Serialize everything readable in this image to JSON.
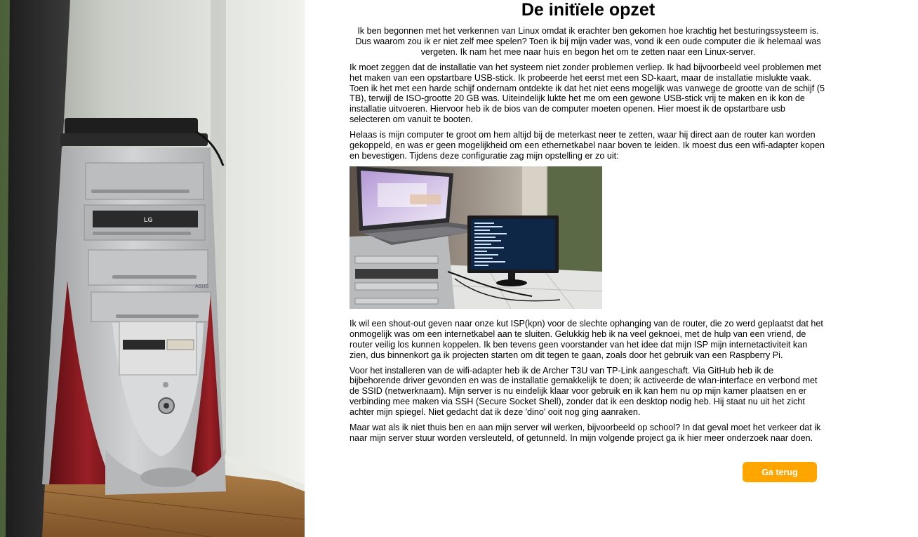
{
  "article": {
    "title": "De initïele opzet",
    "intro": "Ik ben begonnen met het verkennen van Linux omdat ik erachter ben gekomen hoe krachtig het besturingssysteem is. Dus waarom zou ik er niet zelf mee spelen? Toen ik bij mijn vader was, vond ik een oude computer die ik helemaal was vergeten. Ik nam het mee naar huis en begon het om te zetten naar een Linux-server.",
    "paragraph_install": "Ik moet zeggen dat de installatie van het systeem niet zonder problemen verliep. Ik had bijvoorbeeld veel problemen met het maken van een opstartbare USB-stick. Ik probeerde het eerst met een SD-kaart, maar de installatie mislukte vaak. Toen ik het met een harde schijf ondernam ontdekte ik dat het niet eens mogelijk was vanwege de grootte van de schijf (5 TB), terwijl de ISO-grootte 20 GB was. Uiteindelijk lukte het me om een gewone USB-stick vrij te maken en ik kon de installatie uitvoeren. Hiervoor heb ik de bios van de computer moeten openen. Hier moest ik de opstartbare usb selecteren om vanuit te booten.",
    "paragraph_wifi": "Helaas is mijn computer te groot om hem altijd bij de meterkast neer te zetten, waar hij direct aan de router kan worden gekoppeld, en was er geen mogelijkheid om een ethernetkabel naar boven te leiden. Ik moest dus een wifi-adapter kopen en bevestigen. Tijdens deze configuratie zag mijn opstelling er zo uit:",
    "paragraph_isp": "Ik wil een shout-out geven naar onze kut ISP(kpn) voor de slechte ophanging van de router, die zo werd geplaatst dat het onmogelijk was om een internetkabel aan te sluiten. Gelukkig heb ik na veel geknoei, met de hulp van een vriend, de router veilig los kunnen koppelen. Ik ben tevens geen voorstander van het idee dat mijn ISP mijn internetactiviteit kan zien, dus binnenkort ga ik projecten starten om dit tegen te gaan, zoals door het gebruik van een Raspberry Pi.",
    "paragraph_adapter": "Voor het installeren van de wifi-adapter heb ik de Archer T3U van TP-Link aangeschaft. Via GitHub heb ik de bijbehorende driver gevonden en was de installatie gemakkelijk te doen; ik activeerde de wlan-interface en verbond met de SSID (netwerknaam). Mijn server is nu eindelijk klaar voor gebruik en ik kan hem nu op mijn kamer plaatsen en er verbinding mee maken via SSH (Secure Socket Shell), zonder dat ik een desktop nodig heb. Hij staat nu uit het zicht achter mijn spiegel. Niet gedacht dat ik deze 'dino' ooit nog ging aanraken.",
    "paragraph_next": "Maar wat als ik niet thuis ben en aan mijn server wil werken, bijvoorbeeld op school? In dat geval moet het verkeer dat ik naar mijn server stuur worden versleuteld, of getunneld. In mijn volgende project ga ik hier meer onderzoek naar doen.",
    "back_label": "Ga terug"
  },
  "photos": {
    "tower_brand": "LG",
    "tower_case_brand": "ASUS"
  },
  "colors": {
    "button_bg": "#ffa500",
    "button_text": "#ffffff",
    "case_red": "#8e1c22",
    "case_silver": "#c9c9c9"
  }
}
